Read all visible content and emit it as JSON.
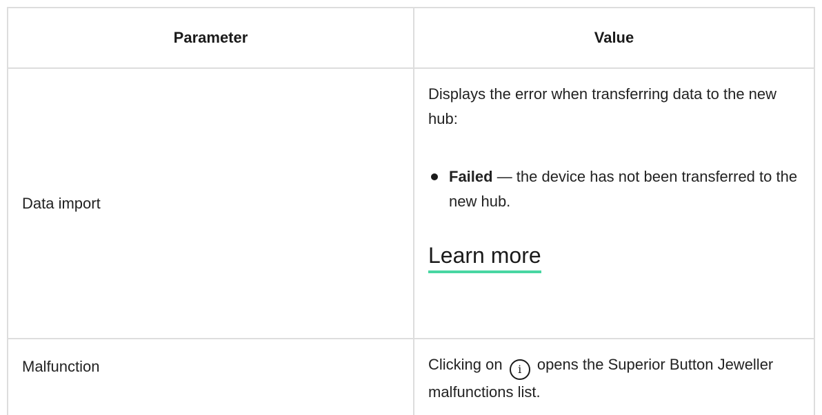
{
  "table": {
    "headers": [
      "Parameter",
      "Value"
    ],
    "rows": [
      {
        "parameter": "Data import",
        "value": {
          "intro": "Displays the error when transferring data to the new hub:",
          "bullet_bold": "Failed",
          "bullet_text": " — the device has not been transferred to the new hub.",
          "link": "Learn more"
        }
      },
      {
        "parameter": "Malfunction",
        "value": {
          "before_icon": "Clicking on ",
          "icon": "info-icon",
          "icon_glyph": "i",
          "after_icon": " opens the Superior Button Jeweller malfunctions list."
        }
      }
    ]
  },
  "colors": {
    "border": "#dddddd",
    "link_underline": "#48d6a2",
    "text": "#222222"
  }
}
